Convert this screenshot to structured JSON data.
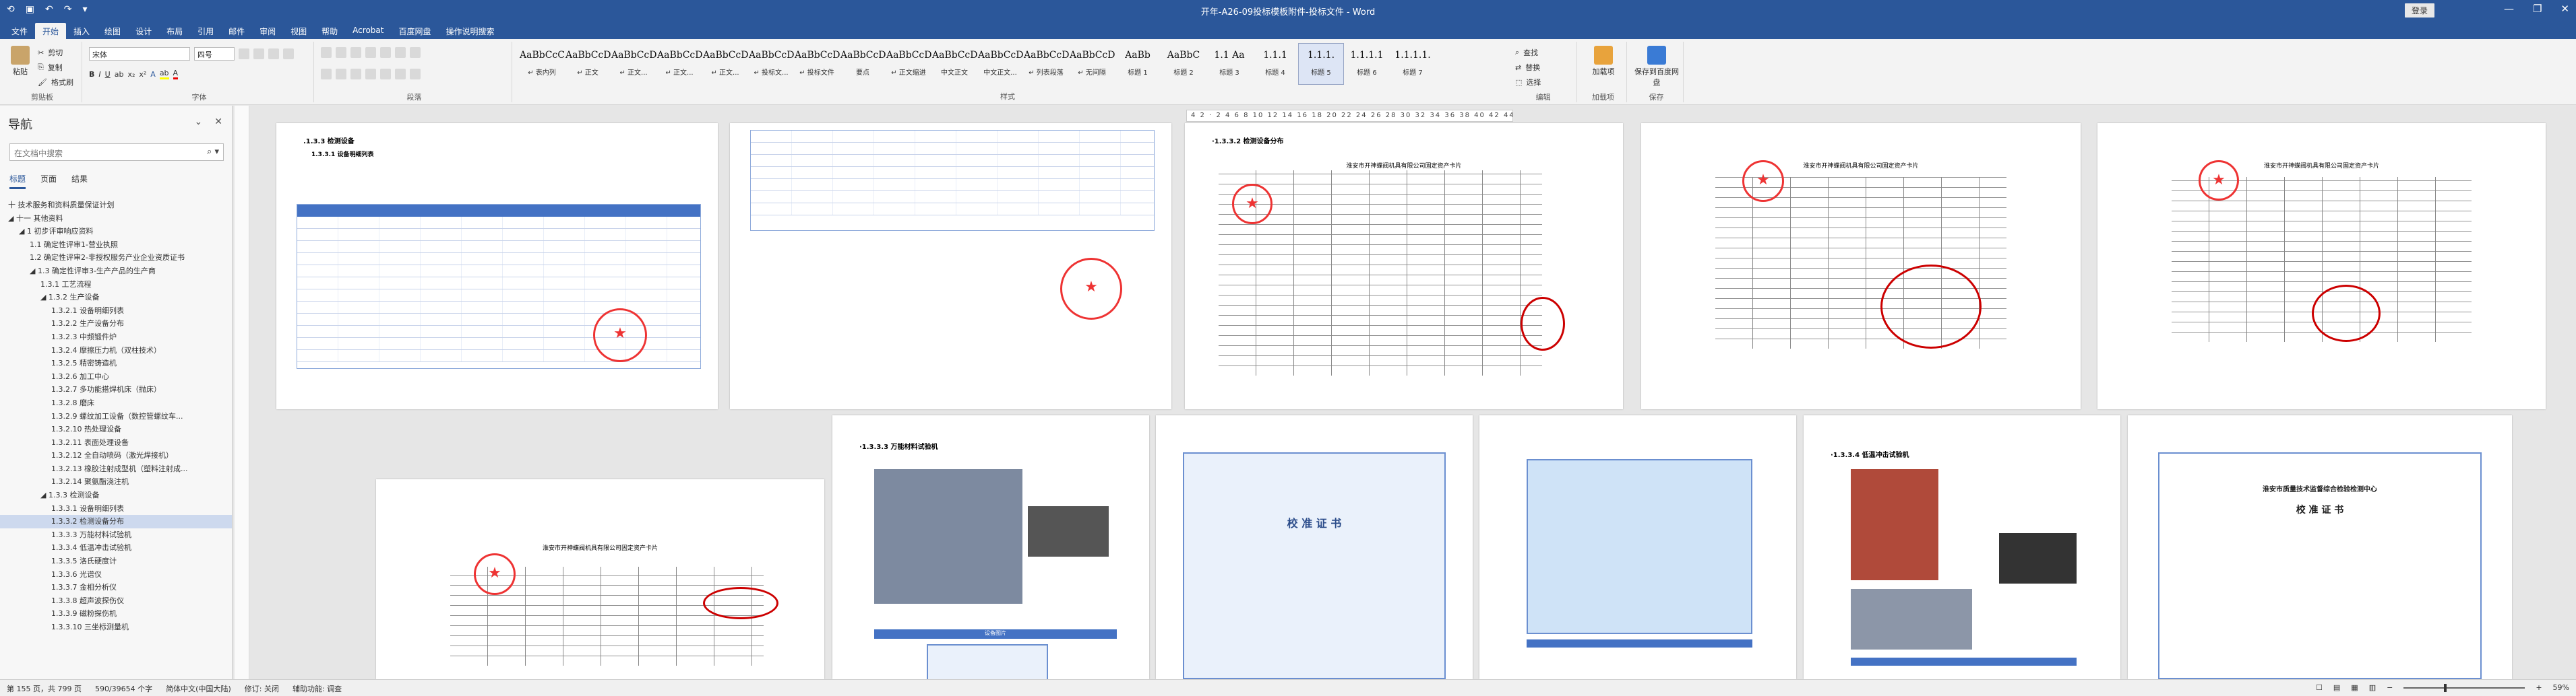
{
  "window": {
    "title": "开年-A26-09投标模板附件-投标文件 - Word",
    "sign_in": "登录",
    "controls": [
      "—",
      "❐",
      "✕"
    ]
  },
  "ribbon_tabs": [
    "文件",
    "开始",
    "插入",
    "绘图",
    "设计",
    "布局",
    "引用",
    "邮件",
    "审阅",
    "视图",
    "帮助",
    "Acrobat",
    "百度网盘",
    "操作说明搜索"
  ],
  "ribbon": {
    "clipboard": {
      "paste": "粘贴",
      "cut": "剪切",
      "copy": "复制",
      "format_painter": "格式刷",
      "label": "剪贴板"
    },
    "font": {
      "font_name": "宋体",
      "font_size": "四号",
      "label": "字体"
    },
    "paragraph": {
      "label": "段落"
    },
    "styles": {
      "items": [
        {
          "preview": "AaBbCcC",
          "name": "↵ 表内列"
        },
        {
          "preview": "AaBbCcD",
          "name": "↵ 正文"
        },
        {
          "preview": "AaBbCcD",
          "name": "↵ 正文..."
        },
        {
          "preview": "AaBbCcD",
          "name": "↵ 正文..."
        },
        {
          "preview": "AaBbCcD",
          "name": "↵ 正文..."
        },
        {
          "preview": "AaBbCcD",
          "name": "↵ 投标文..."
        },
        {
          "preview": "AaBbCcD",
          "name": "↵ 投标文件"
        },
        {
          "preview": "AaBbCcD",
          "name": "要点"
        },
        {
          "preview": "AaBbCcD",
          "name": "↵ 正文缩进"
        },
        {
          "preview": "AaBbCcD",
          "name": "中文正文"
        },
        {
          "preview": "AaBbCcD",
          "name": "中文正文..."
        },
        {
          "preview": "AaBbCcD",
          "name": "↵ 列表段落"
        },
        {
          "preview": "AaBbCcD",
          "name": "↵ 无间隔"
        },
        {
          "preview": "AaBb",
          "name": "标题 1"
        },
        {
          "preview": "AaBbC",
          "name": "标题 2"
        },
        {
          "preview": "1.1 Aa",
          "name": "标题 3"
        },
        {
          "preview": "1.1.1",
          "name": "标题 4"
        },
        {
          "preview": "1.1.1.",
          "name": "标题 5"
        },
        {
          "preview": "1.1.1.1",
          "name": "标题 6"
        },
        {
          "preview": "1.1.1.1.",
          "name": "标题 7"
        }
      ],
      "label": "样式"
    },
    "editing": {
      "find": "查找",
      "replace": "替换",
      "select": "选择",
      "label": "编辑"
    },
    "addin": {
      "name": "加载项",
      "label": "加载项"
    },
    "save": {
      "name": "保存到百度网盘",
      "label": "保存"
    }
  },
  "nav": {
    "header": "导航",
    "search_placeholder": "在文档中搜索",
    "tabs": [
      "标题",
      "页面",
      "结果"
    ],
    "items": [
      {
        "level": 0,
        "text": "十 技术服务和资料质量保证计划",
        "sel": false
      },
      {
        "level": 0,
        "text": "◢ 十一 其他资料",
        "sel": false
      },
      {
        "level": 1,
        "text": "◢ 1 初步评审响应资料",
        "sel": false
      },
      {
        "level": 2,
        "text": "1.1 确定性评审1-营业执照",
        "sel": false
      },
      {
        "level": 2,
        "text": "1.2 确定性评审2-非授权服务产业企业资质证书",
        "sel": false
      },
      {
        "level": 2,
        "text": "◢ 1.3 确定性评审3-生产产品的生产商",
        "sel": false
      },
      {
        "level": 3,
        "text": "1.3.1 工艺流程",
        "sel": false
      },
      {
        "level": 3,
        "text": "◢ 1.3.2 生产设备",
        "sel": false
      },
      {
        "level": 4,
        "text": "1.3.2.1 设备明细列表",
        "sel": false
      },
      {
        "level": 4,
        "text": "1.3.2.2 生产设备分布",
        "sel": false
      },
      {
        "level": 4,
        "text": "1.3.2.3 中频锻件炉",
        "sel": false
      },
      {
        "level": 4,
        "text": "1.3.2.4 摩擦压力机（双柱技术）",
        "sel": false
      },
      {
        "level": 4,
        "text": "1.3.2.5 精密铸造机",
        "sel": false
      },
      {
        "level": 4,
        "text": "1.3.2.6 加工中心",
        "sel": false
      },
      {
        "level": 4,
        "text": "1.3.2.7 多功能搭焊机床（抛床）",
        "sel": false
      },
      {
        "level": 4,
        "text": "1.3.2.8 磨床",
        "sel": false
      },
      {
        "level": 4,
        "text": "1.3.2.9 螺纹加工设备（数控管螺纹车...",
        "sel": false
      },
      {
        "level": 4,
        "text": "1.3.2.10 热处理设备",
        "sel": false
      },
      {
        "level": 4,
        "text": "1.3.2.11 表面处理设备",
        "sel": false
      },
      {
        "level": 4,
        "text": "1.3.2.12 全自动喷码（激光焊接机）",
        "sel": false
      },
      {
        "level": 4,
        "text": "1.3.2.13 橡胶注射成型机（塑料注射成...",
        "sel": false
      },
      {
        "level": 4,
        "text": "1.3.2.14 聚氨酯浇注机",
        "sel": false
      },
      {
        "level": 3,
        "text": "◢ 1.3.3 检测设备",
        "sel": false
      },
      {
        "level": 4,
        "text": "1.3.3.1 设备明细列表",
        "sel": false
      },
      {
        "level": 4,
        "text": "1.3.3.2 检测设备分布",
        "sel": true
      },
      {
        "level": 4,
        "text": "1.3.3.3 万能材料试验机",
        "sel": false
      },
      {
        "level": 4,
        "text": "1.3.3.4 低温冲击试验机",
        "sel": false
      },
      {
        "level": 4,
        "text": "1.3.3.5 洛氏硬度计",
        "sel": false
      },
      {
        "level": 4,
        "text": "1.3.3.6 光谱仪",
        "sel": false
      },
      {
        "level": 4,
        "text": "1.3.3.7 金相分析仪",
        "sel": false
      },
      {
        "level": 4,
        "text": "1.3.3.8 超声波探伤仪",
        "sel": false
      },
      {
        "level": 4,
        "text": "1.3.3.9 磁粉探伤机",
        "sel": false
      },
      {
        "level": 4,
        "text": "1.3.3.10 三坐标测量机",
        "sel": false
      }
    ]
  },
  "ruler_text": "4 2 · 2 4 6 8 10 12 14 16 18 20 22 24 26 28 30 32 34 36 38 40 42 44 46 48",
  "pages": {
    "p1_heading": ".1.3.3 检测设备",
    "p1_sub": "1.3.3.1 设备明细列表",
    "p3_heading": "·1.3.3.2 检测设备分布",
    "p7_heading": "·1.3.3.3 万能材料试验机",
    "p10_heading": "·1.3.3.4 低温冲击试验机",
    "table_title": "淮安市开神蝶阀机具有限公司固定资产卡片",
    "cert_title": "校 准 证 书",
    "cert_org": "淮安市质量技术监督综合检验检测中心",
    "photo_caption": "设备图片"
  },
  "status": {
    "page": "第 155 页，共 799 页",
    "words": "590/39654 个字",
    "lang": "简体中文(中国大陆)",
    "track": "修订: 关闭",
    "access": "辅助功能: 调查",
    "zoom": "59%"
  }
}
